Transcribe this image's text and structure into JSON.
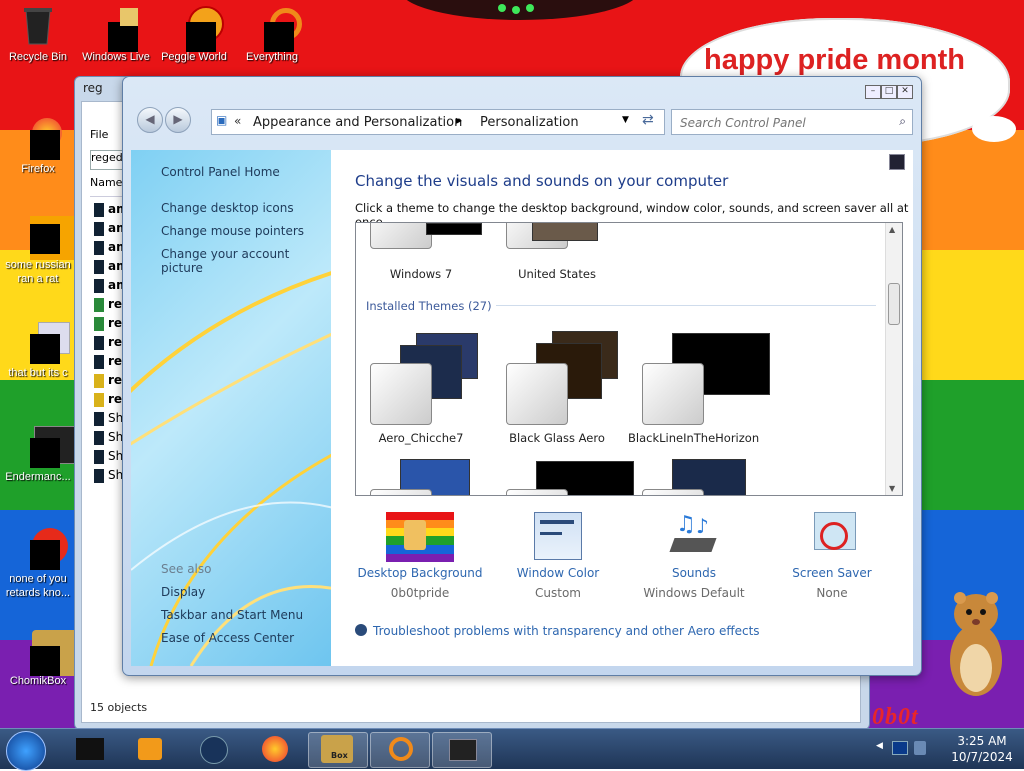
{
  "desktop": {
    "banner": "happy pride month",
    "corner_text": "0b0t",
    "icons": [
      {
        "label": "Recycle Bin"
      },
      {
        "label": "Windows Live"
      },
      {
        "label": "Peggle World"
      },
      {
        "label": "Everything"
      },
      {
        "label": "Firefox"
      },
      {
        "label": "some russian ran a rat"
      },
      {
        "label": "that but its c"
      },
      {
        "label": "Endermanc..."
      },
      {
        "label": "none of you retards kno..."
      },
      {
        "label": "ChomikBox"
      }
    ]
  },
  "regedit": {
    "title": "reg",
    "menu_file": "File",
    "address": "regedit",
    "column_name": "Name",
    "items": [
      "am",
      "am",
      "am",
      "am",
      "am",
      "reg",
      "reg",
      "reg",
      "reg",
      "reg",
      "reg",
      "She",
      "She",
      "She",
      "She"
    ],
    "status": "15 objects"
  },
  "control_panel": {
    "breadcrumb": [
      "Appearance and Personalization",
      "Personalization"
    ],
    "search_placeholder": "Search Control Panel",
    "left": {
      "home": "Control Panel Home",
      "links": [
        "Change desktop icons",
        "Change mouse pointers",
        "Change your account picture"
      ],
      "see_also_title": "See also",
      "see_also": [
        "Display",
        "Taskbar and Start Menu",
        "Ease of Access Center"
      ]
    },
    "heading": "Change the visuals and sounds on your computer",
    "subheading": "Click a theme to change the desktop background, window color, sounds, and screen saver all at once.",
    "top_themes": [
      "Windows 7",
      "United States"
    ],
    "installed_header": "Installed Themes (27)",
    "installed_themes": [
      "Aero_Chicche7",
      "Black Glass Aero",
      "BlackLineInTheHorizon"
    ],
    "bottom": [
      {
        "label": "Desktop Background",
        "value": "0b0tpride"
      },
      {
        "label": "Window Color",
        "value": "Custom"
      },
      {
        "label": "Sounds",
        "value": "Windows Default"
      },
      {
        "label": "Screen Saver",
        "value": "None"
      }
    ],
    "troubleshoot": "Troubleshoot problems with transparency and other Aero effects"
  },
  "taskbar": {
    "time": "3:25 AM",
    "date": "10/7/2024",
    "chomik_label": "Box"
  }
}
